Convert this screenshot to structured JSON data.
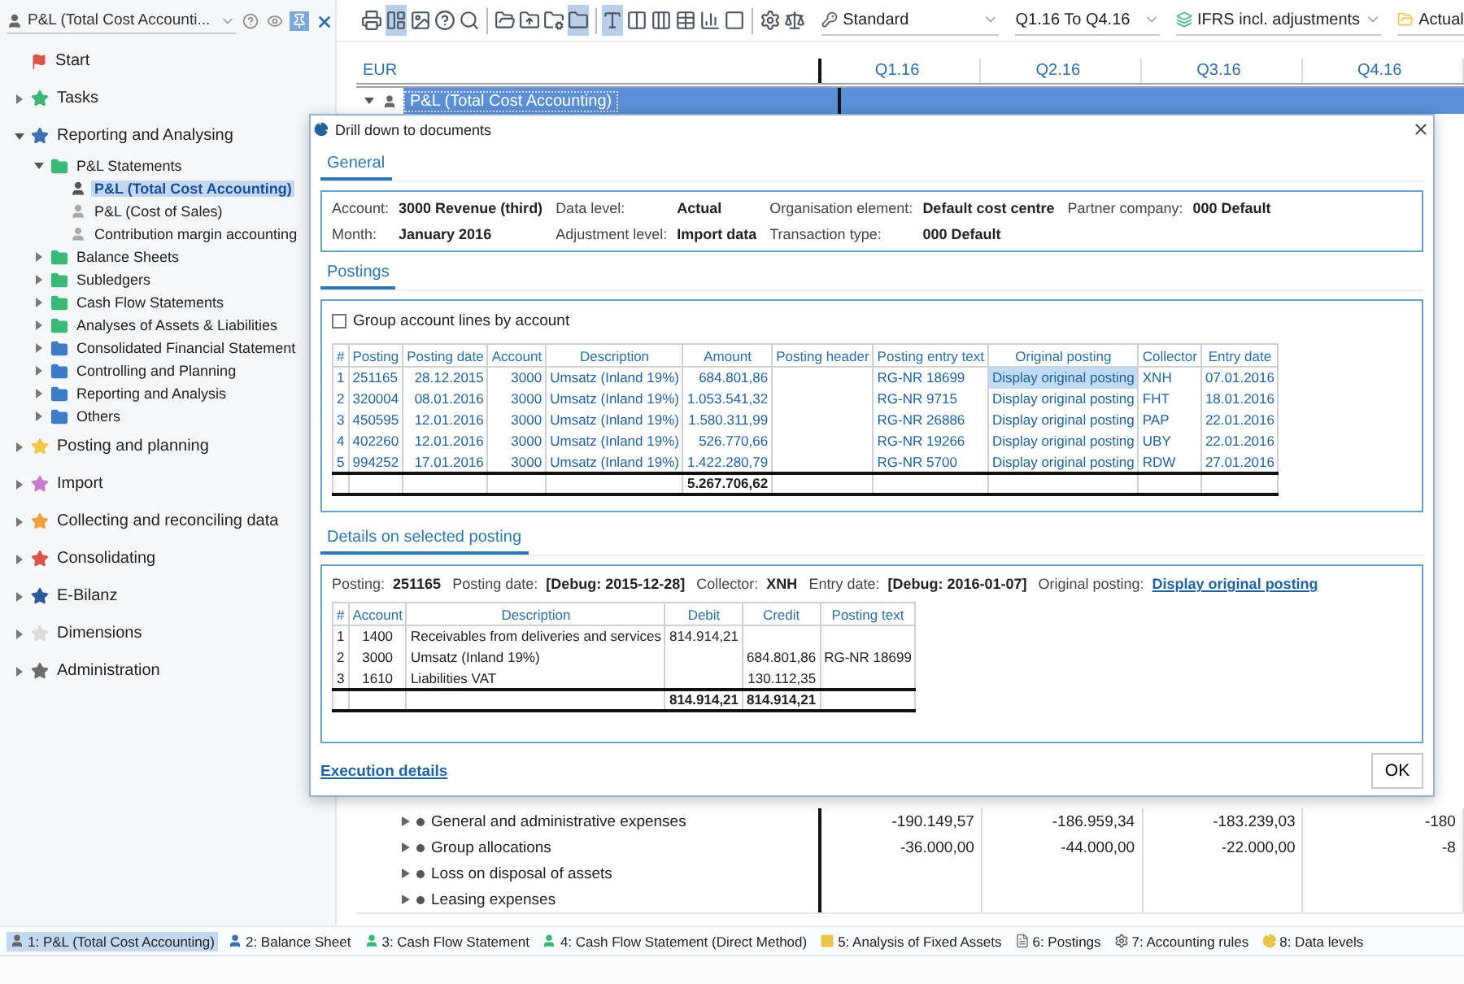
{
  "sidebar": {
    "title": "P&L (Total Cost Accounti...",
    "tree": [
      {
        "label": "Start",
        "kind": "flag"
      },
      {
        "label": "Tasks",
        "kind": "star",
        "color": "#3cb878",
        "expanded": false
      },
      {
        "label": "Reporting and Analysing",
        "kind": "star",
        "color": "#3d6fb5",
        "expanded": true,
        "children": [
          {
            "label": "P&L Statements",
            "kind": "folder",
            "color": "#3cb878",
            "expanded": true,
            "children": [
              {
                "label": "P&L (Total Cost Accounting)",
                "kind": "report",
                "selected": true
              },
              {
                "label": "P&L (Cost of Sales)",
                "kind": "report",
                "selected": false
              },
              {
                "label": "Contribution margin accounting",
                "kind": "report",
                "selected": false
              }
            ]
          },
          {
            "label": "Balance Sheets",
            "kind": "folder",
            "color": "#3cb878",
            "expanded": false
          },
          {
            "label": "Subledgers",
            "kind": "folder",
            "color": "#3cb878",
            "expanded": false
          },
          {
            "label": "Cash Flow Statements",
            "kind": "folder",
            "color": "#3cb878",
            "expanded": false
          },
          {
            "label": "Analyses of Assets & Liabilities",
            "kind": "folder",
            "color": "#3cb878",
            "expanded": false
          },
          {
            "label": "Consolidated Financial Statement",
            "kind": "folder",
            "color": "#3d7cc9",
            "expanded": false
          },
          {
            "label": "Controlling and Planning",
            "kind": "folder",
            "color": "#3d7cc9",
            "expanded": false
          },
          {
            "label": "Reporting and Analysis",
            "kind": "folder",
            "color": "#3d7cc9",
            "expanded": false
          },
          {
            "label": "Others",
            "kind": "folder",
            "color": "#3d7cc9",
            "expanded": false
          }
        ]
      },
      {
        "label": "Posting and planning",
        "kind": "star",
        "color": "#f2c94c",
        "expanded": false
      },
      {
        "label": "Import",
        "kind": "star",
        "color": "#c77dc9",
        "expanded": false
      },
      {
        "label": "Collecting and reconciling data",
        "kind": "star",
        "color": "#f2a03d",
        "expanded": false
      },
      {
        "label": "Consolidating",
        "kind": "star",
        "color": "#d9534f",
        "expanded": false
      },
      {
        "label": "E-Bilanz",
        "kind": "star",
        "color": "#2d5a9c",
        "expanded": false
      },
      {
        "label": "Dimensions",
        "kind": "star",
        "color": "#dcdcdc",
        "expanded": false
      },
      {
        "label": "Administration",
        "kind": "star",
        "color": "#6e6e6e",
        "expanded": false
      }
    ]
  },
  "toolbar": {
    "buttons": [
      {
        "selected": false
      },
      {
        "selected": true
      },
      {
        "selected": false
      },
      {
        "selected": false
      },
      {
        "selected": false
      },
      {
        "selected": false
      },
      {
        "selected": false
      },
      {
        "selected": false
      },
      {
        "selected": true
      },
      {
        "selected": true
      },
      {
        "selected": false
      },
      {
        "selected": false
      },
      {
        "selected": false
      },
      {
        "selected": false
      },
      {
        "selected": false
      },
      {
        "selected": false
      },
      {
        "selected": false
      }
    ],
    "dropdowns": [
      "Standard",
      "Q1.16 To Q4.16",
      "IFRS incl. adjustments",
      "Actual"
    ]
  },
  "report": {
    "columns": [
      "EUR",
      "Q1.16",
      "Q2.16",
      "Q3.16",
      "Q4.16"
    ],
    "top_row": {
      "label": "P&L (Total Cost Accounting)",
      "selected": true
    },
    "rows": [
      {
        "label": "General and administrative expenses",
        "values": [
          "-190.149,57",
          "-186.959,34",
          "-183.239,03",
          "-180"
        ]
      },
      {
        "label": "Group allocations",
        "values": [
          "-36.000,00",
          "-44.000,00",
          "-22.000,00",
          "-8"
        ]
      },
      {
        "label": "Loss on disposal of assets"
      },
      {
        "label": "Leasing expenses"
      }
    ]
  },
  "dialog": {
    "title": "Drill down to documents",
    "general": {
      "heading": "General",
      "fields": [
        [
          {
            "label": "Account:",
            "value": "3000 Revenue (third)"
          },
          {
            "label": "Data level:",
            "value": "Actual"
          },
          {
            "label": "Organisation element:",
            "value": "Default cost centre"
          },
          {
            "label": "Partner company:",
            "value": "000 Default"
          }
        ],
        [
          {
            "label": "Month:",
            "value": "January 2016"
          },
          {
            "label": "Adjustment level:",
            "value": "Import data"
          },
          {
            "label": "Transaction type:",
            "value": "000 Default"
          }
        ]
      ]
    },
    "postings": {
      "heading": "Postings",
      "group_checkbox": {
        "label": "Group account lines by account",
        "checked": false
      },
      "columns": [
        "#",
        "Posting",
        "Posting date",
        "Account",
        "Description",
        "Amount",
        "Posting header",
        "Posting entry text",
        "Original posting",
        "Collector",
        "Entry date"
      ],
      "rows": [
        {
          "no": "1",
          "posting": "251165",
          "date": "28.12.2015",
          "account": "3000",
          "description": "Umsatz (Inland 19%)",
          "amount": "684.801,86",
          "entry_text": "RG-NR 18699",
          "original": "Display original posting",
          "collector": "XNH",
          "entry_date": "07.01.2016",
          "selected": true
        },
        {
          "no": "2",
          "posting": "320004",
          "date": "08.01.2016",
          "account": "3000",
          "description": "Umsatz (Inland 19%)",
          "amount": "1.053.541,32",
          "entry_text": "RG-NR 9715",
          "original": "Display original posting",
          "collector": "FHT",
          "entry_date": "18.01.2016",
          "selected": false
        },
        {
          "no": "3",
          "posting": "450595",
          "date": "12.01.2016",
          "account": "3000",
          "description": "Umsatz (Inland 19%)",
          "amount": "1.580.311,99",
          "entry_text": "RG-NR 26886",
          "original": "Display original posting",
          "collector": "PAP",
          "entry_date": "22.01.2016",
          "selected": false
        },
        {
          "no": "4",
          "posting": "402260",
          "date": "12.01.2016",
          "account": "3000",
          "description": "Umsatz (Inland 19%)",
          "amount": "526.770,66",
          "entry_text": "RG-NR 19266",
          "original": "Display original posting",
          "collector": "UBY",
          "entry_date": "22.01.2016",
          "selected": false
        },
        {
          "no": "5",
          "posting": "994252",
          "date": "17.01.2016",
          "account": "3000",
          "description": "Umsatz (Inland 19%)",
          "amount": "1.422.280,79",
          "entry_text": "RG-NR 5700",
          "original": "Display original posting",
          "collector": "RDW",
          "entry_date": "27.01.2016",
          "selected": false
        }
      ],
      "totals": {
        "amount": "5.267.706,62"
      }
    },
    "details": {
      "heading": "Details on selected posting",
      "info": [
        {
          "label": "Posting:",
          "value": "251165"
        },
        {
          "label": "Posting date:",
          "value": "[Debug: 2015-12-28]"
        },
        {
          "label": "Collector:",
          "value": "XNH"
        },
        {
          "label": "Entry date:",
          "value": "[Debug: 2016-01-07]"
        },
        {
          "label": "Original posting:",
          "value": "Display original posting",
          "kind": "link"
        }
      ],
      "columns": [
        "#",
        "Account",
        "Description",
        "Debit",
        "Credit",
        "Posting text"
      ],
      "rows": [
        {
          "no": "1",
          "account": "1400",
          "description": "Receivables from deliveries and services",
          "debit": "814.914,21"
        },
        {
          "no": "2",
          "account": "3000",
          "description": "Umsatz (Inland 19%)",
          "credit": "684.801,86",
          "text": "RG-NR 18699"
        },
        {
          "no": "3",
          "account": "1610",
          "description": "Liabilities VAT",
          "credit": "130.112,35"
        }
      ],
      "totals": {
        "debit": "814.914,21",
        "credit": "814.914,21"
      }
    },
    "footer_link": "Execution details",
    "ok_button": "OK"
  },
  "bottom_tabs": [
    {
      "label": "1: P&L (Total Cost Accounting)",
      "selected": true
    },
    {
      "label": "2: Balance Sheet",
      "selected": false
    },
    {
      "label": "3: Cash Flow Statement",
      "selected": false
    },
    {
      "label": "4: Cash Flow Statement (Direct Method)",
      "selected": false
    },
    {
      "label": "5: Analysis of Fixed Assets",
      "selected": false
    },
    {
      "label": "6: Postings",
      "selected": false
    },
    {
      "label": "7: Accounting rules",
      "selected": false
    },
    {
      "label": "8: Data levels",
      "selected": false
    }
  ]
}
